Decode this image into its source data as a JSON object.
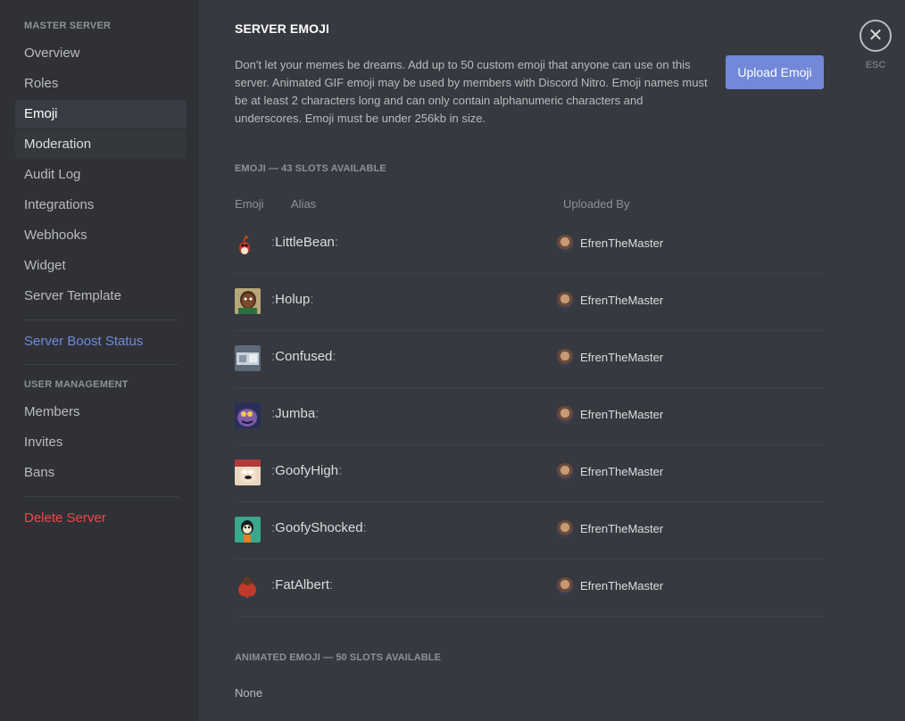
{
  "sidebar": {
    "server_header": "MASTER SERVER",
    "items": [
      {
        "label": "Overview"
      },
      {
        "label": "Roles"
      },
      {
        "label": "Emoji"
      },
      {
        "label": "Moderation"
      },
      {
        "label": "Audit Log"
      },
      {
        "label": "Integrations"
      },
      {
        "label": "Webhooks"
      },
      {
        "label": "Widget"
      },
      {
        "label": "Server Template"
      }
    ],
    "boost_label": "Server Boost Status",
    "user_management_header": "USER MANAGEMENT",
    "user_items": [
      {
        "label": "Members"
      },
      {
        "label": "Invites"
      },
      {
        "label": "Bans"
      }
    ],
    "delete_label": "Delete Server"
  },
  "main": {
    "title": "SERVER EMOJI",
    "description": "Don't let your memes be dreams. Add up to 50 custom emoji that anyone can use on this server. Animated GIF emoji may be used by members with Discord Nitro. Emoji names must be at least 2 characters long and can only contain alphanumeric characters and underscores. Emoji must be under 256kb in size.",
    "upload_button": "Upload Emoji",
    "emoji_section_label": "EMOJI — 43 SLOTS AVAILABLE",
    "columns": {
      "emoji": "Emoji",
      "alias": "Alias",
      "uploaded_by": "Uploaded By"
    },
    "emojis": [
      {
        "alias": "LittleBean",
        "uploader": "EfrenTheMaster",
        "image_icon": "little-bean-emoji-icon"
      },
      {
        "alias": "Holup",
        "uploader": "EfrenTheMaster",
        "image_icon": "holup-emoji-icon"
      },
      {
        "alias": "Confused",
        "uploader": "EfrenTheMaster",
        "image_icon": "confused-emoji-icon"
      },
      {
        "alias": "Jumba",
        "uploader": "EfrenTheMaster",
        "image_icon": "jumba-emoji-icon"
      },
      {
        "alias": "GoofyHigh",
        "uploader": "EfrenTheMaster",
        "image_icon": "goofy-high-emoji-icon"
      },
      {
        "alias": "GoofyShocked",
        "uploader": "EfrenTheMaster",
        "image_icon": "goofy-shocked-emoji-icon"
      },
      {
        "alias": "FatAlbert",
        "uploader": "EfrenTheMaster",
        "image_icon": "fat-albert-emoji-icon"
      }
    ],
    "colon": ":",
    "animated_section_label": "ANIMATED EMOJI — 50 SLOTS AVAILABLE",
    "animated_empty": "None"
  },
  "close": {
    "esc_label": "ESC",
    "icon": "close-icon"
  },
  "colors": {
    "sidebar_bg": "#2f3136",
    "main_bg": "#36393f",
    "accent": "#7289da",
    "danger": "#f04747"
  }
}
